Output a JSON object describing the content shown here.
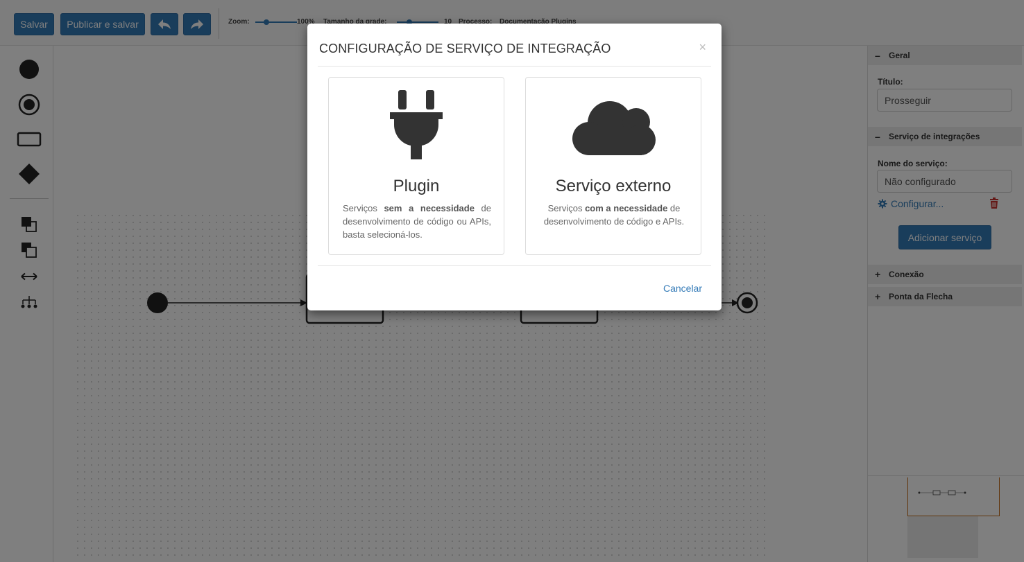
{
  "toolbar": {
    "save_label": "Salvar",
    "publish_label": "Publicar e salvar",
    "zoom_label": "Zoom:",
    "zoom_value": "100%",
    "grid_label": "Tamanho da grade:",
    "grid_value": "10",
    "process_label": "Processo:",
    "process_value": "Documentação Plugins",
    "undo_icon": "undo-arrow-icon",
    "redo_icon": "redo-arrow-icon"
  },
  "palette": {
    "items": [
      "start-event-icon",
      "end-event-icon",
      "task-icon",
      "gateway-icon",
      "bring-front-icon",
      "send-back-icon",
      "horizontal-arrows-icon",
      "tree-layout-icon"
    ]
  },
  "panel": {
    "sections": {
      "general": {
        "sign": "–",
        "label": "Geral"
      },
      "integration": {
        "sign": "–",
        "label": "Serviço de integrações"
      },
      "connection": {
        "sign": "+",
        "label": "Conexão"
      },
      "arrowhead": {
        "sign": "+",
        "label": "Ponta da Flecha"
      }
    },
    "title_label": "Título:",
    "title_value": "Prosseguir",
    "service_label": "Nome do serviço:",
    "service_value": "Não configurado",
    "configure_label": "Configurar...",
    "add_service_label": "Adicionar serviço"
  },
  "modal": {
    "title": "CONFIGURAÇÃO DE SERVIÇO DE INTEGRAÇÃO",
    "close": "×",
    "cancel_label": "Cancelar",
    "cards": {
      "plugin": {
        "icon": "plug-icon",
        "title": "Plugin",
        "desc_pre": "Serviços ",
        "desc_bold": "sem a necessidade",
        "desc_post": " de desenvolvimento de código ou APIs, basta selecioná-los."
      },
      "external": {
        "icon": "cloud-icon",
        "title": "Serviço externo",
        "desc_pre": "Serviços ",
        "desc_bold": "com a necessidade",
        "desc_post": " de desenvolvimento de código e APIs."
      }
    }
  },
  "colors": {
    "primary": "#337ab7",
    "overlay": "rgba(0,0,0,0.5)",
    "icon_dark": "#333333",
    "delete_red": "#c9302c",
    "minimap_frame": "#c46b16"
  }
}
